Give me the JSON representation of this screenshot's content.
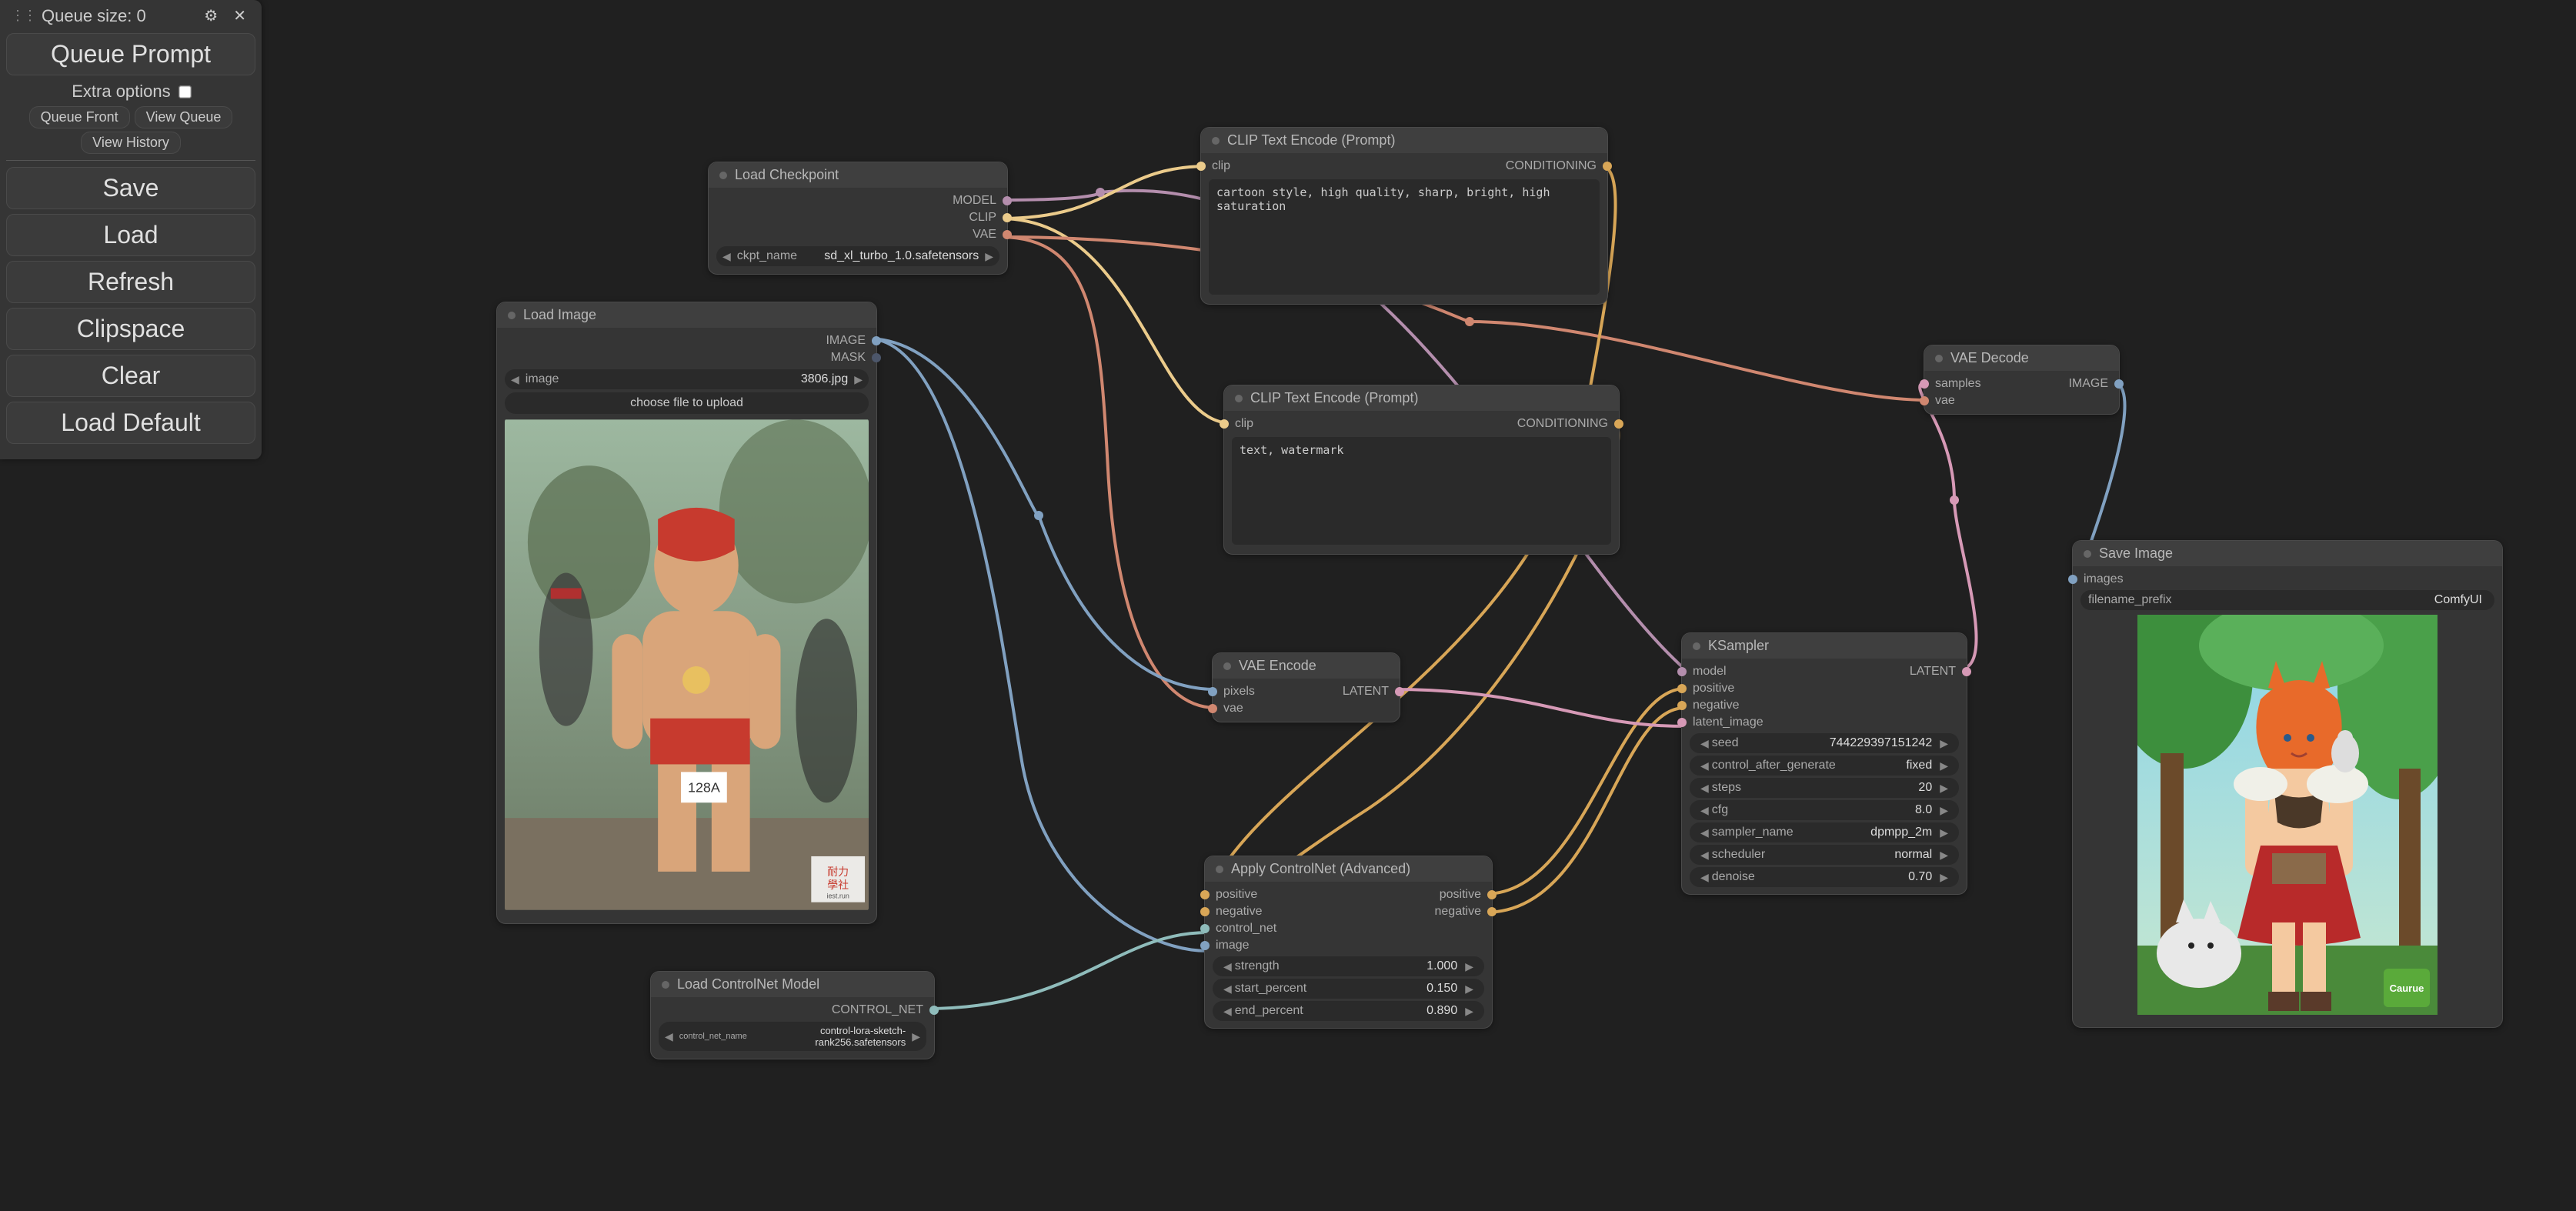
{
  "menu": {
    "queue_size_label": "Queue size: 0",
    "queue_prompt": "Queue Prompt",
    "extra_options": "Extra options",
    "queue_front": "Queue Front",
    "view_queue": "View Queue",
    "view_history": "View History",
    "save": "Save",
    "load": "Load",
    "refresh": "Refresh",
    "clipspace": "Clipspace",
    "clear": "Clear",
    "load_default": "Load Default"
  },
  "nodes": {
    "load_ckpt": {
      "title": "Load Checkpoint",
      "out_model": "MODEL",
      "out_clip": "CLIP",
      "out_vae": "VAE",
      "ckpt_label": "ckpt_name",
      "ckpt_value": "sd_xl_turbo_1.0.safetensors"
    },
    "load_image": {
      "title": "Load Image",
      "out_image": "IMAGE",
      "out_mask": "MASK",
      "image_label": "image",
      "image_value": "3806.jpg",
      "upload": "choose file to upload"
    },
    "clip_pos": {
      "title": "CLIP Text Encode (Prompt)",
      "in_clip": "clip",
      "out_cond": "CONDITIONING",
      "text": "cartoon style, high quality, sharp, bright, high saturation"
    },
    "clip_neg": {
      "title": "CLIP Text Encode (Prompt)",
      "in_clip": "clip",
      "out_cond": "CONDITIONING",
      "text": "text, watermark"
    },
    "vae_encode": {
      "title": "VAE Encode",
      "in_pixels": "pixels",
      "in_vae": "vae",
      "out_latent": "LATENT"
    },
    "load_cn": {
      "title": "Load ControlNet Model",
      "out_cn": "CONTROL_NET",
      "cn_label": "control_net_name",
      "cn_value": "control-lora-sketch-rank256.safetensors"
    },
    "apply_cn": {
      "title": "Apply ControlNet (Advanced)",
      "in_positive": "positive",
      "in_negative": "negative",
      "in_cn": "control_net",
      "in_image": "image",
      "out_positive": "positive",
      "out_negative": "negative",
      "strength_l": "strength",
      "strength_v": "1.000",
      "start_l": "start_percent",
      "start_v": "0.150",
      "end_l": "end_percent",
      "end_v": "0.890"
    },
    "ksampler": {
      "title": "KSampler",
      "in_model": "model",
      "in_positive": "positive",
      "in_negative": "negative",
      "in_latent": "latent_image",
      "out_latent": "LATENT",
      "seed_l": "seed",
      "seed_v": "744229397151242",
      "cag_l": "control_after_generate",
      "cag_v": "fixed",
      "steps_l": "steps",
      "steps_v": "20",
      "cfg_l": "cfg",
      "cfg_v": "8.0",
      "sampler_l": "sampler_name",
      "sampler_v": "dpmpp_2m",
      "sched_l": "scheduler",
      "sched_v": "normal",
      "denoise_l": "denoise",
      "denoise_v": "0.70"
    },
    "vae_decode": {
      "title": "VAE Decode",
      "in_samples": "samples",
      "in_vae": "vae",
      "out_image": "IMAGE"
    },
    "save_image": {
      "title": "Save Image",
      "in_images": "images",
      "prefix_l": "filename_prefix",
      "prefix_v": "ComfyUI"
    }
  }
}
